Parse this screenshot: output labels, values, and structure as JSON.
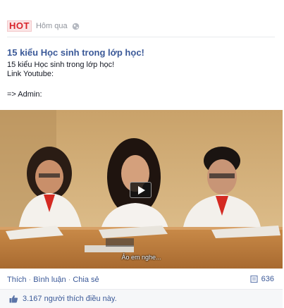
{
  "header": {
    "badge": "HOT",
    "time": "Hôm qua",
    "privacy_icon": "globe-icon"
  },
  "post": {
    "title": "15 kiểu Học sinh trong lớp học!",
    "line1": "15 kiểu Học sinh trong lớp học!",
    "line2": "Link Youtube:",
    "line3": "=> Admin:"
  },
  "video": {
    "subtitle": "Ảo em nghe...",
    "play_icon": "play-icon"
  },
  "actions": {
    "like": "Thích",
    "comment": "Bình luận",
    "share": "Chia sẻ",
    "separator": "·",
    "share_count": "636",
    "share_icon": "share-count-icon"
  },
  "likes": {
    "text": "3.167 người thích điều này.",
    "icon": "thumbs-up-icon"
  },
  "colors": {
    "link": "#3b5998",
    "badge_red": "#d8232a",
    "muted": "#90949c"
  }
}
